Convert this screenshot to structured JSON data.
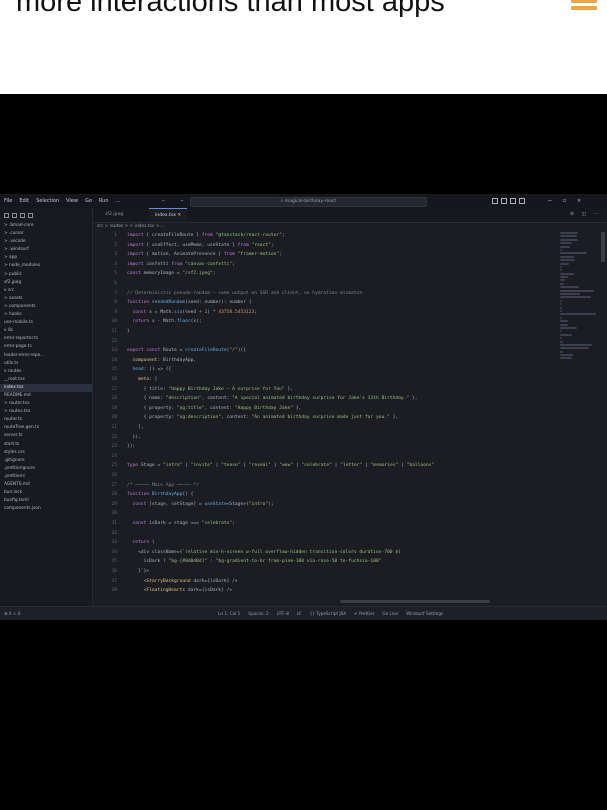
{
  "caption": {
    "text": "more interactions than most apps"
  },
  "titlebar": {
    "menu": [
      "File",
      "Edit",
      "Selection",
      "View",
      "Go",
      "Run",
      "…"
    ],
    "nav_arrows": "← →",
    "search_text": "⌕ magical-birthday-react",
    "window_controls": [
      "—",
      "☐",
      "✕"
    ]
  },
  "sidebar": {
    "items": [
      {
        "label": "> .bmad-core",
        "active": false
      },
      {
        "label": "> .cursor",
        "active": false
      },
      {
        "label": "> .vscode",
        "active": false
      },
      {
        "label": "> .windsurf",
        "active": false
      },
      {
        "label": "> app",
        "active": false
      },
      {
        "label": "> node_modules",
        "active": false
      },
      {
        "label": "> public",
        "active": false
      },
      {
        "label": "  sf2.jpeg",
        "active": false
      },
      {
        "label": "v src",
        "active": false
      },
      {
        "label": "  > assets",
        "active": false
      },
      {
        "label": "  > components",
        "active": false
      },
      {
        "label": "  > hooks",
        "active": false
      },
      {
        "label": "    use-mobile.ts",
        "active": false
      },
      {
        "label": "  v lib",
        "active": false
      },
      {
        "label": "    error-reporter.ts",
        "active": false
      },
      {
        "label": "    error-page.ts",
        "active": false
      },
      {
        "label": "    loader-error-repo...",
        "active": false
      },
      {
        "label": "    utils.ts",
        "active": false
      },
      {
        "label": "  v routes",
        "active": false
      },
      {
        "label": "    __root.tsx",
        "active": false
      },
      {
        "label": "    index.tsx",
        "active": true
      },
      {
        "label": "    README.md",
        "active": false
      },
      {
        "label": "  > router.tsx",
        "active": false
      },
      {
        "label": "  > routes.tsx",
        "active": false
      },
      {
        "label": "    router.ts",
        "active": false
      },
      {
        "label": "    routeTree.gen.ts",
        "active": false
      },
      {
        "label": "    server.ts",
        "active": false
      },
      {
        "label": "    start.ts",
        "active": false
      },
      {
        "label": "    styles.css",
        "active": false
      },
      {
        "label": "  .gitignore",
        "active": false
      },
      {
        "label": "  .prettierignore",
        "active": false
      },
      {
        "label": "  .prettierrc",
        "active": false
      },
      {
        "label": "  AGENTS.md",
        "active": false
      },
      {
        "label": "  bun.lock",
        "active": false
      },
      {
        "label": "  bunfig.toml",
        "active": false
      },
      {
        "label": "  components.json",
        "active": false
      }
    ]
  },
  "tabs": [
    {
      "label": "sf2.jpeg",
      "active": false
    },
    {
      "label": "index.tsx ✕",
      "active": true
    }
  ],
  "breadcrumb": "src > routes > ⚛ index.tsx > …",
  "code": [
    {
      "n": "1",
      "parts": [
        [
          "kw",
          "import "
        ],
        [
          "txt",
          "{ createFileRoute } "
        ],
        [
          "kw",
          "from "
        ],
        [
          "str",
          "\"@tanstack/react-router\""
        ],
        [
          "txt",
          ";"
        ]
      ]
    },
    {
      "n": "2",
      "parts": [
        [
          "kw",
          "import "
        ],
        [
          "txt",
          "{ useEffect, useMemo, useState } "
        ],
        [
          "kw",
          "from "
        ],
        [
          "str",
          "\"react\""
        ],
        [
          "txt",
          ";"
        ]
      ]
    },
    {
      "n": "3",
      "parts": [
        [
          "kw",
          "import "
        ],
        [
          "txt",
          "{ motion, AnimatePresence } "
        ],
        [
          "kw",
          "from "
        ],
        [
          "str",
          "\"framer-motion\""
        ],
        [
          "txt",
          ";"
        ]
      ]
    },
    {
      "n": "4",
      "parts": [
        [
          "kw",
          "import "
        ],
        [
          "txt",
          "confetti "
        ],
        [
          "kw",
          "from "
        ],
        [
          "str",
          "\"canvas-confetti\""
        ],
        [
          "txt",
          ";"
        ]
      ]
    },
    {
      "n": "5",
      "parts": [
        [
          "kw",
          "const "
        ],
        [
          "txt",
          "memoryImage = "
        ],
        [
          "str",
          "\"/sf2.jpeg\""
        ],
        [
          "txt",
          ";"
        ]
      ]
    },
    {
      "n": "6",
      "parts": []
    },
    {
      "n": "7",
      "parts": [
        [
          "com",
          "// Deterministic pseudo-random — same output on SSR and client, no hydration mismatch"
        ]
      ]
    },
    {
      "n": "8",
      "parts": [
        [
          "kw",
          "function "
        ],
        [
          "fn",
          "seededRandom"
        ],
        [
          "txt",
          "(seed: number): number {"
        ]
      ]
    },
    {
      "n": "9",
      "parts": [
        [
          "kw",
          "  const "
        ],
        [
          "txt",
          "x = Math."
        ],
        [
          "fn",
          "sin"
        ],
        [
          "txt",
          "(seed + "
        ],
        [
          "num",
          "1"
        ],
        [
          "txt",
          ") * "
        ],
        [
          "num",
          "43758.5453123"
        ],
        [
          "txt",
          ";"
        ]
      ]
    },
    {
      "n": "10",
      "parts": [
        [
          "kw",
          "  return "
        ],
        [
          "txt",
          "x - Math."
        ],
        [
          "fn",
          "floor"
        ],
        [
          "txt",
          "(x);"
        ]
      ]
    },
    {
      "n": "11",
      "parts": [
        [
          "txt",
          "}"
        ]
      ]
    },
    {
      "n": "12",
      "parts": []
    },
    {
      "n": "13",
      "parts": [
        [
          "kw",
          "export const "
        ],
        [
          "txt",
          "Route = "
        ],
        [
          "fn",
          "createFileRoute"
        ],
        [
          "txt",
          "("
        ],
        [
          "str",
          "\"/\""
        ],
        [
          "txt",
          ")({"
        ]
      ]
    },
    {
      "n": "14",
      "parts": [
        [
          "prop",
          "  component"
        ],
        [
          "txt",
          ": BirthdayApp,"
        ]
      ]
    },
    {
      "n": "15",
      "parts": [
        [
          "fn",
          "  head"
        ],
        [
          "txt",
          ": () => ({"
        ]
      ]
    },
    {
      "n": "16",
      "parts": [
        [
          "prop",
          "    meta"
        ],
        [
          "txt",
          ": ["
        ]
      ]
    },
    {
      "n": "17",
      "parts": [
        [
          "txt",
          "      { title: "
        ],
        [
          "str",
          "\"Happy Birthday Jake — A surprise for You\""
        ],
        [
          "txt",
          " },"
        ]
      ]
    },
    {
      "n": "18",
      "parts": [
        [
          "txt",
          "      { name: "
        ],
        [
          "str",
          "\"description\""
        ],
        [
          "txt",
          ", content: "
        ],
        [
          "str",
          "\"A special animated birthday surprise for Jake's 13th Birthday.\""
        ],
        [
          "txt",
          " },"
        ]
      ]
    },
    {
      "n": "19",
      "parts": [
        [
          "txt",
          "      { property: "
        ],
        [
          "str",
          "\"og:title\""
        ],
        [
          "txt",
          ", content: "
        ],
        [
          "str",
          "\"Happy Birthday Jake\""
        ],
        [
          "txt",
          " },"
        ]
      ]
    },
    {
      "n": "20",
      "parts": [
        [
          "txt",
          "      { property: "
        ],
        [
          "str",
          "\"og:description\""
        ],
        [
          "txt",
          ", content: "
        ],
        [
          "str",
          "\"An animated birthday surprise made just for you.\""
        ],
        [
          "txt",
          " },"
        ]
      ]
    },
    {
      "n": "21",
      "parts": [
        [
          "txt",
          "    ],"
        ]
      ]
    },
    {
      "n": "22",
      "parts": [
        [
          "txt",
          "  }),"
        ]
      ]
    },
    {
      "n": "23",
      "parts": [
        [
          "txt",
          "});"
        ]
      ]
    },
    {
      "n": "24",
      "parts": []
    },
    {
      "n": "25",
      "parts": [
        [
          "kw",
          "type "
        ],
        [
          "txt",
          "Stage = "
        ],
        [
          "str",
          "\"intro\""
        ],
        [
          "txt",
          " | "
        ],
        [
          "str",
          "\"invite\""
        ],
        [
          "txt",
          " | "
        ],
        [
          "str",
          "\"tease\""
        ],
        [
          "txt",
          " | "
        ],
        [
          "str",
          "\"reveal\""
        ],
        [
          "txt",
          " | "
        ],
        [
          "str",
          "\"wow\""
        ],
        [
          "txt",
          " | "
        ],
        [
          "str",
          "\"celebrate\""
        ],
        [
          "txt",
          " | "
        ],
        [
          "str",
          "\"letter\""
        ],
        [
          "txt",
          " | "
        ],
        [
          "str",
          "\"memories\""
        ],
        [
          "txt",
          " | "
        ],
        [
          "str",
          "\"balloons\""
        ]
      ]
    },
    {
      "n": "26",
      "parts": []
    },
    {
      "n": "27",
      "parts": [
        [
          "com",
          "/* ───── Main App ───── */"
        ]
      ]
    },
    {
      "n": "28",
      "parts": [
        [
          "kw",
          "function "
        ],
        [
          "fn",
          "BirthdayApp"
        ],
        [
          "txt",
          "() {"
        ]
      ]
    },
    {
      "n": "29",
      "parts": [
        [
          "kw",
          "  const "
        ],
        [
          "txt",
          "[stage, setStage] = "
        ],
        [
          "fn",
          "useState"
        ],
        [
          "txt",
          "<Stage>("
        ],
        [
          "str",
          "\"intro\""
        ],
        [
          "txt",
          ");"
        ]
      ]
    },
    {
      "n": "30",
      "parts": []
    },
    {
      "n": "31",
      "parts": [
        [
          "kw",
          "  const "
        ],
        [
          "txt",
          "isDark = stage === "
        ],
        [
          "str",
          "\"celebrate\""
        ],
        [
          "txt",
          ";"
        ]
      ]
    },
    {
      "n": "32",
      "parts": []
    },
    {
      "n": "33",
      "parts": [
        [
          "kw",
          "  return "
        ],
        [
          "txt",
          "("
        ]
      ]
    },
    {
      "n": "34",
      "parts": [
        [
          "txt",
          "    <div className="
        ],
        [
          "str",
          "{`relative min-h-screen w-full overflow-hidden transition-colors duration-700 ${"
        ]
      ]
    },
    {
      "n": "35",
      "parts": [
        [
          "txt",
          "      isDark ? "
        ],
        [
          "str",
          "\"bg-[#0d0d0d]\""
        ],
        [
          "txt",
          " : "
        ],
        [
          "str",
          "\"bg-gradient-to-br from-pink-100 via-rose-50 to-fuchsia-100\""
        ]
      ]
    },
    {
      "n": "36",
      "parts": [
        [
          "txt",
          "    }`}>"
        ]
      ]
    },
    {
      "n": "37",
      "parts": [
        [
          "txt",
          "      <"
        ],
        [
          "prop",
          "StarryBackground"
        ],
        [
          "txt",
          " dark={isDark} />"
        ]
      ]
    },
    {
      "n": "38",
      "parts": [
        [
          "txt",
          "      <"
        ],
        [
          "prop",
          "FloatingHearts"
        ],
        [
          "txt",
          " dark={isDark} />"
        ]
      ]
    }
  ],
  "statusbar": {
    "left": "⊗ 0 ⚠ 0",
    "items": [
      "Ln 1, Col 1",
      "Spaces: 2",
      "UTF-8",
      "LF",
      "{} TypeScript JSX",
      "✔ Prettier",
      "Go Live",
      "Windsurf Settings"
    ]
  }
}
